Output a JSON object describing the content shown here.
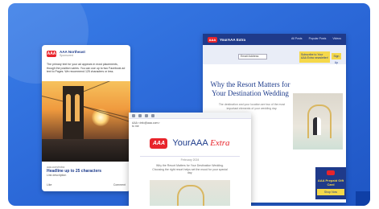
{
  "fb_ad": {
    "page_name": "AAA Northeast",
    "page_sub": "Sponsored",
    "body_text": "The primary text for your ad appears in most placements, though the position varies. You can use up to two Facebook ad text to Pages. We recommend 125 characters or less.",
    "link_url": "aaa.com/extra",
    "headline": "Headline up to 25 characters",
    "description": "Link description",
    "like_label": "Like",
    "comment_label": "Comment"
  },
  "site": {
    "brand_logo": "AAA",
    "brand_name": "YourAAA Extra",
    "nav": [
      "All Posts",
      "Popular Posts",
      "Videos"
    ],
    "search_value": "Email Address",
    "signup_text": "Subscribe to Your AAA Extra newsletter!",
    "signup_button": "Sign Up",
    "title": "Why the Resort Matters for Your Destination Wedding",
    "intro": "The destination and your location are two of the most important elements of your wedding day.",
    "ad_title": "AAA Prepaid Gift Card",
    "ad_button": "Shop Now"
  },
  "email": {
    "from": "AAA <info@aaa.com>",
    "to": "to me",
    "logo": "AAA",
    "brand_main": "YourAAA ",
    "brand_extra": "Extra",
    "date": "February 2024",
    "body": "Why the Resort Matters for Your Destination Wedding. Choosing the right resort helps set the mood for your special day."
  },
  "colors": {
    "background": "#2a66d6",
    "aaa_red": "#e8242b",
    "aaa_blue": "#1d3b8b",
    "accent_yellow": "#f5d84a"
  }
}
